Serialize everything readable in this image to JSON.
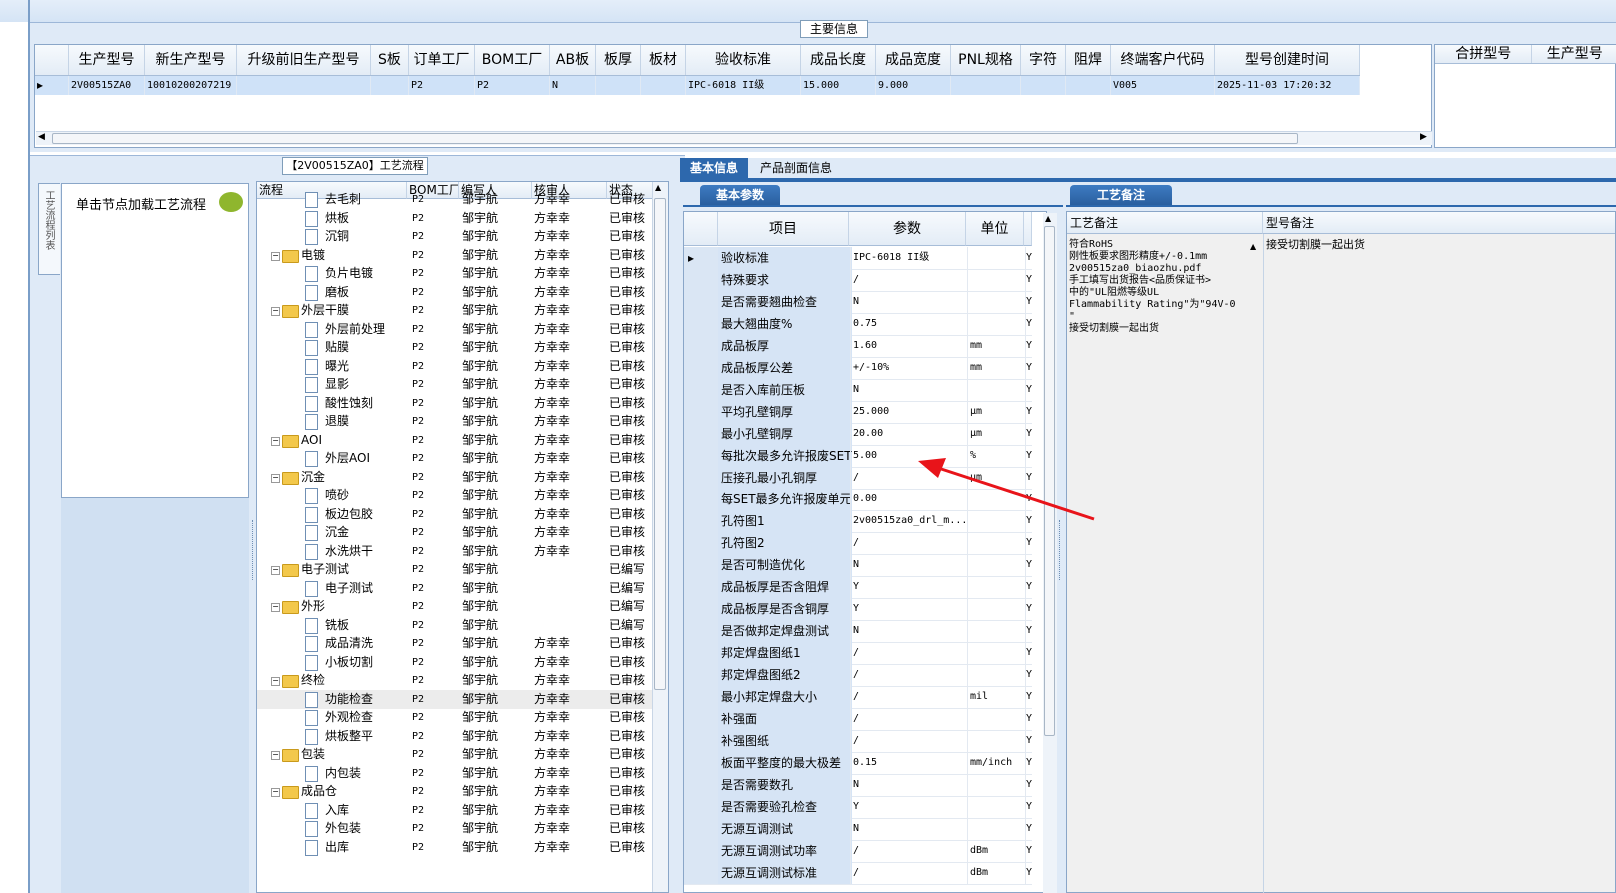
{
  "main_panel": {
    "title": "主要信息",
    "columns": [
      "生产型号",
      "新生产型号",
      "升级前旧生产型号",
      "S板",
      "订单工厂",
      "BOM工厂",
      "AB板",
      "板厚",
      "板材",
      "验收标准",
      "成品长度",
      "成品宽度",
      "PNL规格",
      "字符",
      "阻焊",
      "终端客户代码",
      "型号创建时间"
    ],
    "row": [
      "2V00515ZA0",
      "10010200207219",
      "",
      "",
      "P2",
      "P2",
      "N",
      "",
      "",
      "IPC-6018 II级",
      "15.000",
      "9.000",
      "",
      "",
      "",
      "V005",
      "2025-11-03 17:20:32"
    ],
    "right_columns": [
      "合拼型号",
      "生产型号"
    ]
  },
  "process_panel": {
    "title": "【2V00515ZA0】工艺流程",
    "side_tab": "工艺流程列表",
    "loader_text": "单击节点加载工艺流程",
    "columns": [
      "流程",
      "BOM工厂",
      "编写人",
      "核审人",
      "状态"
    ],
    "rows": [
      {
        "level": 2,
        "type": "doc",
        "name": "去毛刺",
        "bom": "P2",
        "writer": "邹宇航",
        "reviewer": "方幸幸",
        "status": "已审核"
      },
      {
        "level": 2,
        "type": "doc",
        "name": "烘板",
        "bom": "P2",
        "writer": "邹宇航",
        "reviewer": "方幸幸",
        "status": "已审核"
      },
      {
        "level": 2,
        "type": "doc",
        "name": "沉铜",
        "bom": "P2",
        "writer": "邹宇航",
        "reviewer": "方幸幸",
        "status": "已审核"
      },
      {
        "level": 1,
        "type": "folder",
        "name": "电镀",
        "bom": "P2",
        "writer": "邹宇航",
        "reviewer": "方幸幸",
        "status": "已审核"
      },
      {
        "level": 2,
        "type": "doc",
        "name": "负片电镀",
        "bom": "P2",
        "writer": "邹宇航",
        "reviewer": "方幸幸",
        "status": "已审核"
      },
      {
        "level": 2,
        "type": "doc",
        "name": "磨板",
        "bom": "P2",
        "writer": "邹宇航",
        "reviewer": "方幸幸",
        "status": "已审核"
      },
      {
        "level": 1,
        "type": "folder",
        "name": "外层干膜",
        "bom": "P2",
        "writer": "邹宇航",
        "reviewer": "方幸幸",
        "status": "已审核"
      },
      {
        "level": 2,
        "type": "doc",
        "name": "外层前处理",
        "bom": "P2",
        "writer": "邹宇航",
        "reviewer": "方幸幸",
        "status": "已审核"
      },
      {
        "level": 2,
        "type": "doc",
        "name": "贴膜",
        "bom": "P2",
        "writer": "邹宇航",
        "reviewer": "方幸幸",
        "status": "已审核"
      },
      {
        "level": 2,
        "type": "doc",
        "name": "曝光",
        "bom": "P2",
        "writer": "邹宇航",
        "reviewer": "方幸幸",
        "status": "已审核"
      },
      {
        "level": 2,
        "type": "doc",
        "name": "显影",
        "bom": "P2",
        "writer": "邹宇航",
        "reviewer": "方幸幸",
        "status": "已审核"
      },
      {
        "level": 2,
        "type": "doc",
        "name": "酸性蚀刻",
        "bom": "P2",
        "writer": "邹宇航",
        "reviewer": "方幸幸",
        "status": "已审核"
      },
      {
        "level": 2,
        "type": "doc",
        "name": "退膜",
        "bom": "P2",
        "writer": "邹宇航",
        "reviewer": "方幸幸",
        "status": "已审核"
      },
      {
        "level": 1,
        "type": "folder",
        "name": "AOI",
        "bom": "P2",
        "writer": "邹宇航",
        "reviewer": "方幸幸",
        "status": "已审核"
      },
      {
        "level": 2,
        "type": "doc",
        "name": "外层AOI",
        "bom": "P2",
        "writer": "邹宇航",
        "reviewer": "方幸幸",
        "status": "已审核"
      },
      {
        "level": 1,
        "type": "folder",
        "name": "沉金",
        "bom": "P2",
        "writer": "邹宇航",
        "reviewer": "方幸幸",
        "status": "已审核"
      },
      {
        "level": 2,
        "type": "doc",
        "name": "喷砂",
        "bom": "P2",
        "writer": "邹宇航",
        "reviewer": "方幸幸",
        "status": "已审核"
      },
      {
        "level": 2,
        "type": "doc",
        "name": "板边包胶",
        "bom": "P2",
        "writer": "邹宇航",
        "reviewer": "方幸幸",
        "status": "已审核"
      },
      {
        "level": 2,
        "type": "doc",
        "name": "沉金",
        "bom": "P2",
        "writer": "邹宇航",
        "reviewer": "方幸幸",
        "status": "已审核"
      },
      {
        "level": 2,
        "type": "doc",
        "name": "水洗烘干",
        "bom": "P2",
        "writer": "邹宇航",
        "reviewer": "方幸幸",
        "status": "已审核"
      },
      {
        "level": 1,
        "type": "folder",
        "name": "电子测试",
        "bom": "P2",
        "writer": "邹宇航",
        "reviewer": "",
        "status": "已编写"
      },
      {
        "level": 2,
        "type": "doc",
        "name": "电子测试",
        "bom": "P2",
        "writer": "邹宇航",
        "reviewer": "",
        "status": "已编写"
      },
      {
        "level": 1,
        "type": "folder",
        "name": "外形",
        "bom": "P2",
        "writer": "邹宇航",
        "reviewer": "",
        "status": "已编写"
      },
      {
        "level": 2,
        "type": "doc",
        "name": "铣板",
        "bom": "P2",
        "writer": "邹宇航",
        "reviewer": "",
        "status": "已编写"
      },
      {
        "level": 2,
        "type": "doc",
        "name": "成品清洗",
        "bom": "P2",
        "writer": "邹宇航",
        "reviewer": "方幸幸",
        "status": "已审核"
      },
      {
        "level": 2,
        "type": "doc",
        "name": "小板切割",
        "bom": "P2",
        "writer": "邹宇航",
        "reviewer": "方幸幸",
        "status": "已审核"
      },
      {
        "level": 1,
        "type": "folder",
        "name": "终检",
        "bom": "P2",
        "writer": "邹宇航",
        "reviewer": "方幸幸",
        "status": "已审核"
      },
      {
        "level": 2,
        "type": "doc",
        "name": "功能检查",
        "bom": "P2",
        "writer": "邹宇航",
        "reviewer": "方幸幸",
        "status": "已审核",
        "selected": true
      },
      {
        "level": 2,
        "type": "doc",
        "name": "外观检查",
        "bom": "P2",
        "writer": "邹宇航",
        "reviewer": "方幸幸",
        "status": "已审核"
      },
      {
        "level": 2,
        "type": "doc",
        "name": "烘板整平",
        "bom": "P2",
        "writer": "邹宇航",
        "reviewer": "方幸幸",
        "status": "已审核"
      },
      {
        "level": 1,
        "type": "folder",
        "name": "包装",
        "bom": "P2",
        "writer": "邹宇航",
        "reviewer": "方幸幸",
        "status": "已审核"
      },
      {
        "level": 2,
        "type": "doc",
        "name": "内包装",
        "bom": "P2",
        "writer": "邹宇航",
        "reviewer": "方幸幸",
        "status": "已审核"
      },
      {
        "level": 1,
        "type": "folder",
        "name": "成品仓",
        "bom": "P2",
        "writer": "邹宇航",
        "reviewer": "方幸幸",
        "status": "已审核"
      },
      {
        "level": 2,
        "type": "doc",
        "name": "入库",
        "bom": "P2",
        "writer": "邹宇航",
        "reviewer": "方幸幸",
        "status": "已审核"
      },
      {
        "level": 2,
        "type": "doc",
        "name": "外包装",
        "bom": "P2",
        "writer": "邹宇航",
        "reviewer": "方幸幸",
        "status": "已审核"
      },
      {
        "level": 2,
        "type": "doc",
        "name": "出库",
        "bom": "P2",
        "writer": "邹宇航",
        "reviewer": "方幸幸",
        "status": "已审核"
      }
    ]
  },
  "right_panel": {
    "tabs": [
      "基本信息",
      "产品剖面信息"
    ],
    "params_tab": "基本参数",
    "params_columns": [
      "项目",
      "参数",
      "单位"
    ],
    "params": [
      {
        "item": "验收标准",
        "value": "IPC-6018 II级",
        "unit": "",
        "flag": "Y"
      },
      {
        "item": "特殊要求",
        "value": "/",
        "unit": "",
        "flag": "Y"
      },
      {
        "item": "是否需要翘曲检查",
        "value": "N",
        "unit": "",
        "flag": "Y"
      },
      {
        "item": "最大翘曲度%",
        "value": "0.75",
        "unit": "",
        "flag": "Y"
      },
      {
        "item": "成品板厚",
        "value": "1.60",
        "unit": "mm",
        "flag": "Y"
      },
      {
        "item": "成品板厚公差",
        "value": "+/-10%",
        "unit": "mm",
        "flag": "Y"
      },
      {
        "item": "是否入库前压板",
        "value": "N",
        "unit": "",
        "flag": "Y"
      },
      {
        "item": "平均孔壁铜厚",
        "value": "25.000",
        "unit": "μm",
        "flag": "Y"
      },
      {
        "item": "最小孔壁铜厚",
        "value": "20.00",
        "unit": "μm",
        "flag": "Y"
      },
      {
        "item": "每批次最多允许报废SET",
        "value": "5.00",
        "unit": "%",
        "flag": "Y"
      },
      {
        "item": "压接孔最小孔铜厚",
        "value": "/",
        "unit": "μm",
        "flag": "Y"
      },
      {
        "item": "每SET最多允许报废单元",
        "value": "0.00",
        "unit": "",
        "flag": "Y"
      },
      {
        "item": "孔符图1",
        "value": "2v00515za0_drl_m...",
        "unit": "",
        "flag": "Y"
      },
      {
        "item": "孔符图2",
        "value": "/",
        "unit": "",
        "flag": "Y"
      },
      {
        "item": "是否可制造优化",
        "value": "N",
        "unit": "",
        "flag": "Y"
      },
      {
        "item": "成品板厚是否含阻焊",
        "value": "Y",
        "unit": "",
        "flag": "Y"
      },
      {
        "item": "成品板厚是否含铜厚",
        "value": "Y",
        "unit": "",
        "flag": "Y"
      },
      {
        "item": "是否做邦定焊盘测试",
        "value": "N",
        "unit": "",
        "flag": "Y"
      },
      {
        "item": "邦定焊盘图纸1",
        "value": "/",
        "unit": "",
        "flag": "Y"
      },
      {
        "item": "邦定焊盘图纸2",
        "value": "/",
        "unit": "",
        "flag": "Y"
      },
      {
        "item": "最小邦定焊盘大小",
        "value": "/",
        "unit": "mil",
        "flag": "Y"
      },
      {
        "item": "补强面",
        "value": "/",
        "unit": "",
        "flag": "Y"
      },
      {
        "item": "补强图纸",
        "value": "/",
        "unit": "",
        "flag": "Y"
      },
      {
        "item": "板面平整度的最大极差",
        "value": "0.15",
        "unit": "mm/inch",
        "flag": "Y"
      },
      {
        "item": "是否需要数孔",
        "value": "N",
        "unit": "",
        "flag": "Y"
      },
      {
        "item": "是否需要验孔检查",
        "value": "Y",
        "unit": "",
        "flag": "Y"
      },
      {
        "item": "无源互调测试",
        "value": "N",
        "unit": "",
        "flag": "Y"
      },
      {
        "item": "无源互调测试功率",
        "value": "/",
        "unit": "dBm",
        "flag": "Y"
      },
      {
        "item": "无源互调测试标准",
        "value": "/",
        "unit": "dBm",
        "flag": "Y"
      }
    ],
    "notes_tab": "工艺备注",
    "notes_columns": [
      "工艺备注",
      "型号备注"
    ],
    "process_notes": [
      "符合RoHS",
      "",
      "刚性板要求图形精度+/-0.1mm",
      "2v00515za0_biaozhu.pdf",
      "",
      "手工填写出货报告<品质保证书>",
      "中的\"UL阻燃等级UL",
      "Flammability Rating\"为\"94V-0",
      "\"",
      "",
      "接受切割膜一起出货"
    ],
    "model_notes": [
      "接受切割膜一起出货"
    ]
  }
}
